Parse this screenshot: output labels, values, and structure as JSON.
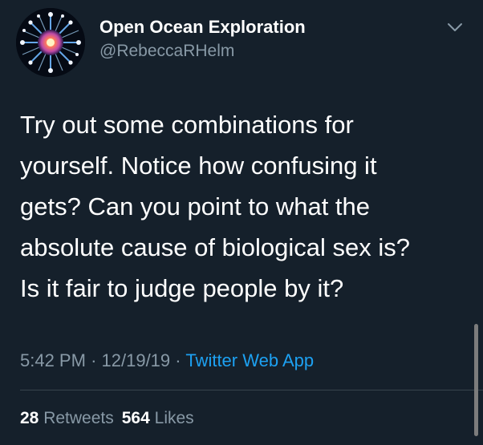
{
  "author": {
    "display_name": "Open Ocean Exploration",
    "handle": "@RebeccaRHelm",
    "avatar_icon": "jellyfish-avatar"
  },
  "tweet": {
    "text": "Try out some combinations for\nyourself. Notice how confusing it\ngets? Can you point to what the\nabsolute cause of biological sex is?\nIs it fair to judge people by it?",
    "time": "5:42 PM",
    "date": "12/19/19",
    "source": "Twitter Web App"
  },
  "stats": {
    "retweets_count": "28",
    "retweets_label": "Retweets",
    "likes_count": "564",
    "likes_label": "Likes"
  },
  "colors": {
    "background": "#15202b",
    "secondary_text": "#8899a6",
    "link": "#1da1f2"
  },
  "icons": [
    "chevron-down-icon"
  ]
}
